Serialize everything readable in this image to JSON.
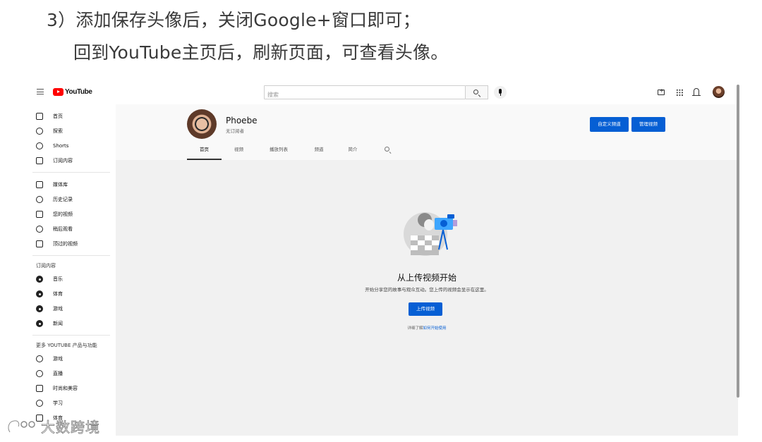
{
  "heading": {
    "line1": "3）添加保存头像后，关闭Google+窗口即可；",
    "line2": "回到YouTube主页后，刷新页面，可查看头像。"
  },
  "topbar": {
    "logo_text": "YouTube",
    "search_placeholder": "搜索",
    "brand_color": "#ff0000",
    "icons": [
      "menu-icon",
      "search-icon",
      "mic-icon",
      "create-icon",
      "apps-icon",
      "bell-icon",
      "avatar"
    ]
  },
  "sidebar": {
    "main_items": [
      {
        "label": "首页",
        "icon": "home-icon"
      },
      {
        "label": "探索",
        "icon": "compass-icon"
      },
      {
        "label": "Shorts",
        "icon": "shorts-icon"
      },
      {
        "label": "订阅内容",
        "icon": "subscriptions-icon"
      }
    ],
    "library_items": [
      {
        "label": "媒体库",
        "icon": "library-icon"
      },
      {
        "label": "历史记录",
        "icon": "history-icon"
      },
      {
        "label": "您的视频",
        "icon": "your-videos-icon"
      },
      {
        "label": "稍后观看",
        "icon": "clock-icon"
      },
      {
        "label": "顶过的视频",
        "icon": "thumbs-up-icon"
      }
    ],
    "subscriptions_title": "订阅内容",
    "subscription_items": [
      {
        "label": "音乐",
        "icon": "music-icon"
      },
      {
        "label": "体育",
        "icon": "trophy-icon"
      },
      {
        "label": "游戏",
        "icon": "gaming-icon"
      },
      {
        "label": "新闻",
        "icon": "news-icon"
      }
    ],
    "more_title": "更多 YOUTUBE 产品与功能",
    "more_items": [
      {
        "label": "游戏",
        "icon": "gamepad-icon"
      },
      {
        "label": "直播",
        "icon": "live-icon"
      },
      {
        "label": "时尚和美容",
        "icon": "hanger-icon"
      },
      {
        "label": "学习",
        "icon": "bulb-icon"
      },
      {
        "label": "体育",
        "icon": "trophy-icon"
      }
    ]
  },
  "channel": {
    "name": "Phoebe",
    "subscribers": "无订阅者",
    "customize_button": "自定义频道",
    "manage_button": "管理视频",
    "accent_color": "#065fd4",
    "tabs": [
      "首页",
      "视频",
      "播放列表",
      "频道",
      "简介"
    ],
    "active_tab": "首页"
  },
  "empty_state": {
    "title": "从上传视频开始",
    "description": "开始分享您的故事与观众互动。您上传的视频会显示在这里。",
    "upload_button": "上传视频",
    "learn_prefix": "详细了解",
    "learn_link": "如何开始使用"
  },
  "watermark": {
    "text": "大数跨境"
  }
}
